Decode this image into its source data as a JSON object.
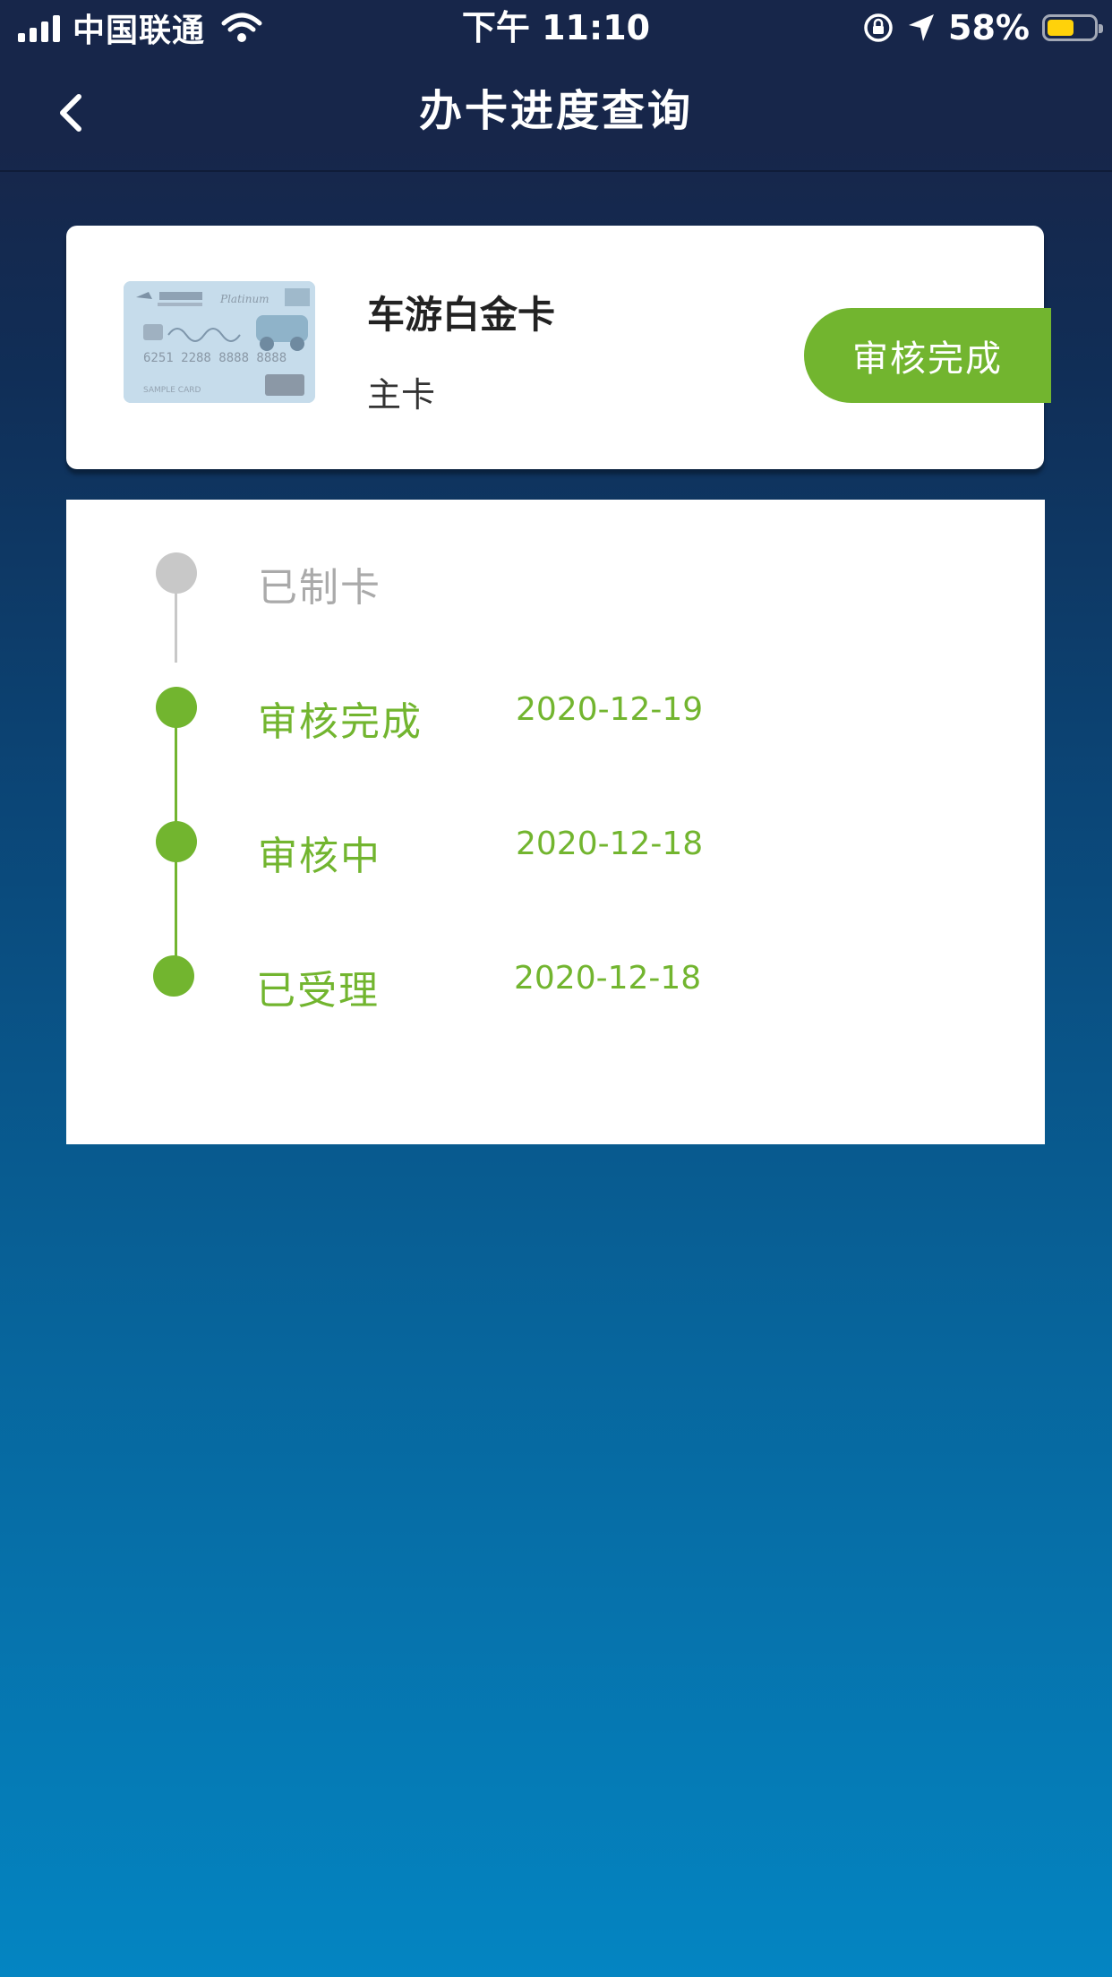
{
  "status_bar": {
    "carrier": "中国联通",
    "time": "下午 11:10",
    "battery": "58%",
    "battery_level": 0.58
  },
  "nav": {
    "back_icon": "chevron-left-icon",
    "title": "办卡进度查询"
  },
  "card": {
    "name": "车游白金卡",
    "type": "主卡",
    "status": "审核完成",
    "image_text": {
      "number": "6251 2288 8888 8888",
      "holder": "SAMPLE CARD"
    }
  },
  "timeline": [
    {
      "label": "已制卡",
      "date": "",
      "state": "pending"
    },
    {
      "label": "审核完成",
      "date": "2020-12-19",
      "state": "done"
    },
    {
      "label": "审核中",
      "date": "2020-12-18",
      "state": "done"
    },
    {
      "label": "已受理",
      "date": "2020-12-18",
      "state": "done"
    }
  ],
  "colors": {
    "accent": "#72b52f",
    "pending": "#c8c8c8",
    "pending_text": "#aaaaaa",
    "header_bg": "#17264a",
    "bottom_bg": "#0485c2"
  }
}
